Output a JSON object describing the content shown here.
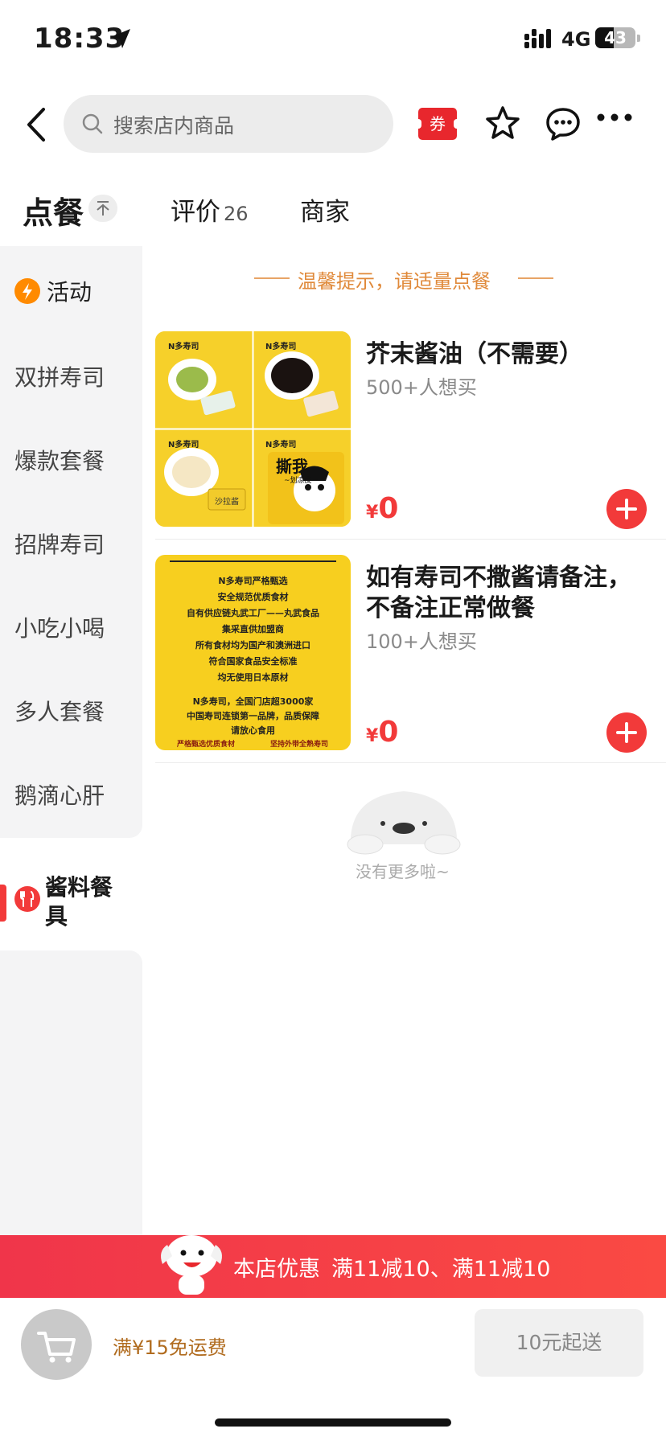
{
  "status_bar": {
    "time": "18:33",
    "network": "4G",
    "battery": "43"
  },
  "nav": {
    "search_placeholder": "搜索店内商品",
    "coupon_label": "券"
  },
  "tabs": [
    {
      "label": "点餐"
    },
    {
      "label": "评价",
      "count": "26"
    },
    {
      "label": "商家"
    }
  ],
  "sidebar": {
    "items": [
      "活动",
      "双拼寿司",
      "爆款套餐",
      "招牌寿司",
      "小吃小喝",
      "多人套餐",
      "鹅滴心肝"
    ],
    "selected": "酱料餐具"
  },
  "tip": "温馨提示，请适量点餐",
  "products": [
    {
      "name": "芥末酱油（不需要）",
      "sales": "500+人想买",
      "currency": "¥",
      "price": "0",
      "image_text": {
        "brand": "N多寿司",
        "pack": "撕我",
        "pack_sub": "~划凉皮~",
        "label": "沙拉酱"
      }
    },
    {
      "name": "如有寿司不撒酱请备注，不备注正常做餐",
      "sales": "100+人想买",
      "currency": "¥",
      "price": "0",
      "image_lines": [
        "N多寿司严格甄选",
        "安全规范优质食材",
        "自有供应链丸武工厂——丸武食品",
        "集采直供加盟商",
        "所有食材均为国产和澳洲进口",
        "符合国家食品安全标准",
        "均无使用日本原材",
        "N多寿司，全国门店超3000家",
        "中国寿司连锁第一品牌，品质保障",
        "请放心食用",
        "严格甄选优质食材",
        "坚持外带全熟寿司"
      ]
    }
  ],
  "empty_text": "没有更多啦~",
  "promo": {
    "title": "本店优惠",
    "detail": "满11减10、满11减10"
  },
  "bottom": {
    "free_shipping": "满¥15免运费",
    "min_order": "10元起送"
  },
  "colors": {
    "accent": "#f23a3a",
    "tip": "#e08a3b",
    "sidebar_bg": "#f4f4f5"
  }
}
